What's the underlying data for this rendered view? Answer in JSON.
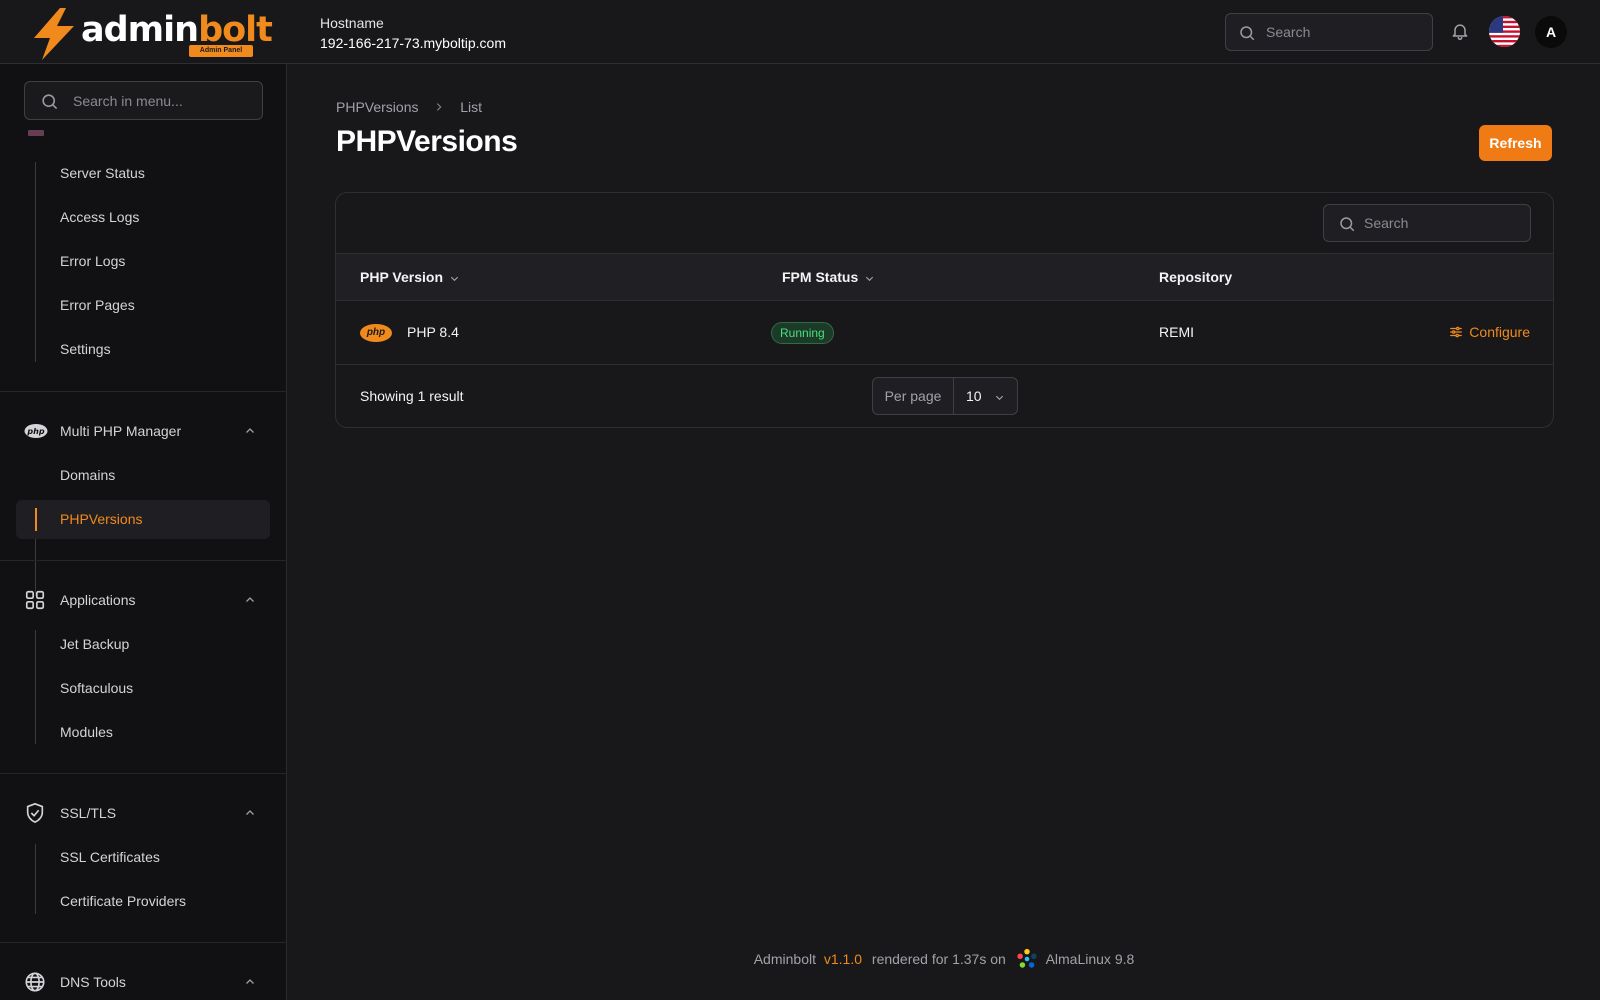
{
  "header": {
    "logo_text_1": "admin",
    "logo_text_2": "bolt",
    "logo_tag": "Admin Panel",
    "hostname_label": "Hostname",
    "hostname_value": "192-166-217-73.myboltip.com",
    "search_placeholder": "Search",
    "avatar_initial": "A",
    "accent_color": "#f08a1c"
  },
  "sidebar": {
    "search_placeholder": "Search in menu...",
    "sections": [
      {
        "items": [
          "Server Status",
          "Access Logs",
          "Error Logs",
          "Error Pages",
          "Settings"
        ]
      },
      {
        "label": "Multi PHP Manager",
        "icon": "php-icon",
        "items": [
          "Domains",
          "PHPVersions"
        ],
        "active_item": "PHPVersions"
      },
      {
        "label": "Applications",
        "icon": "grid-icon",
        "items": [
          "Jet Backup",
          "Softaculous",
          "Modules"
        ]
      },
      {
        "label": "SSL/TLS",
        "icon": "shield-check-icon",
        "items": [
          "SSL Certificates",
          "Certificate Providers"
        ]
      },
      {
        "label": "DNS Tools",
        "icon": "globe-icon",
        "items": []
      }
    ]
  },
  "main": {
    "breadcrumb": [
      "PHPVersions",
      "List"
    ],
    "title": "PHPVersions",
    "refresh_label": "Refresh",
    "table": {
      "search_placeholder": "Search",
      "columns": [
        "PHP Version",
        "FPM Status",
        "Repository"
      ],
      "rows": [
        {
          "icon_text": "php",
          "version": "PHP 8.4",
          "status": "Running",
          "repository": "REMI",
          "action": "Configure"
        }
      ],
      "showing": "Showing 1 result",
      "per_page_label": "Per page",
      "per_page_value": "10"
    }
  },
  "footer": {
    "app": "Adminbolt",
    "version": "v1.1.0",
    "rendered": "rendered for 1.37s on",
    "os": "AlmaLinux 9.8"
  }
}
